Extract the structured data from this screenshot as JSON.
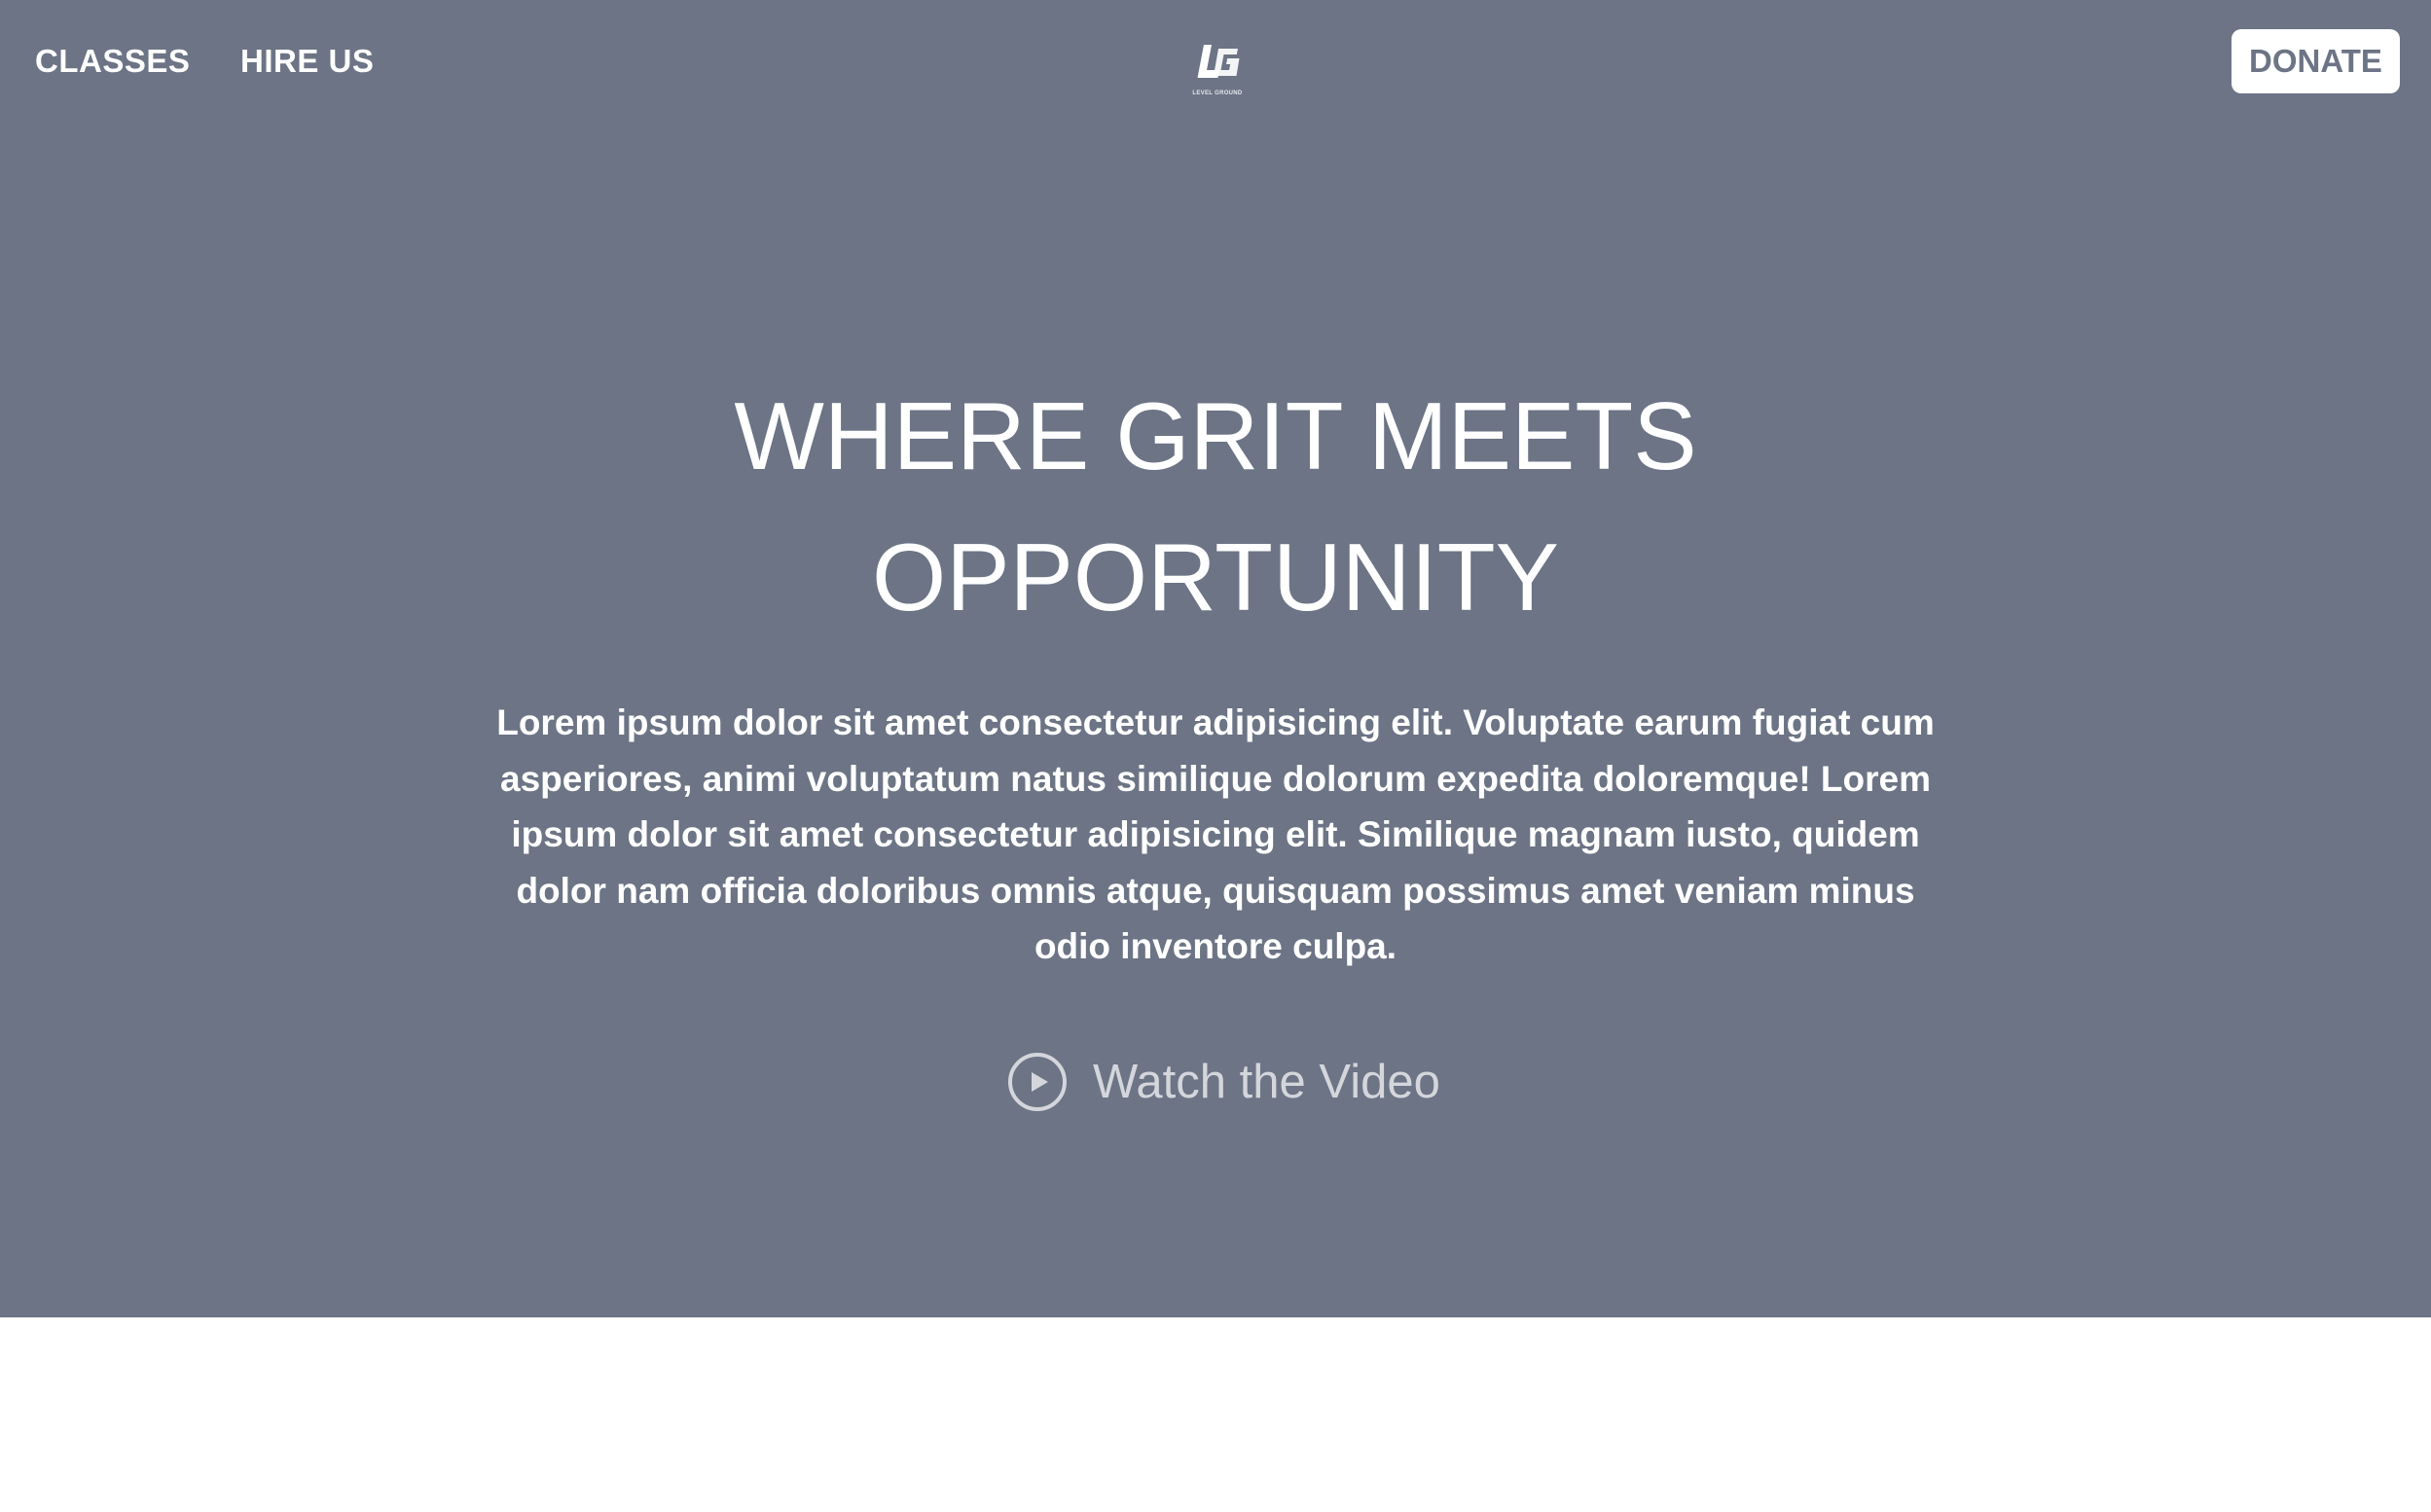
{
  "nav": {
    "classes_label": "CLASSES",
    "hire_label": "HIRE US",
    "donate_label": "DONATE"
  },
  "logo": {
    "icon": "level-ground-logo",
    "caption": "LEVEL GROUND"
  },
  "hero": {
    "title_line1": "WHERE GRIT MEETS",
    "title_line2": "OPPORTUNITY",
    "description": "Lorem ipsum dolor sit amet consectetur adipisicing elit. Voluptate earum fugiat cum asperiores, animi voluptatum natus similique dolorum expedita doloremque! Lorem ipsum dolor sit amet consectetur adipisicing elit. Similique magnam iusto, quidem dolor nam officia doloribus omnis atque, quisquam possimus amet veniam minus odio inventore culpa.",
    "video_label": "Watch the Video",
    "video_icon": "play-circle-icon"
  },
  "colors": {
    "hero_background": "#6c7485",
    "page_background": "#ffffff",
    "text": "#ffffff",
    "video_text": "#d4d6dc"
  }
}
